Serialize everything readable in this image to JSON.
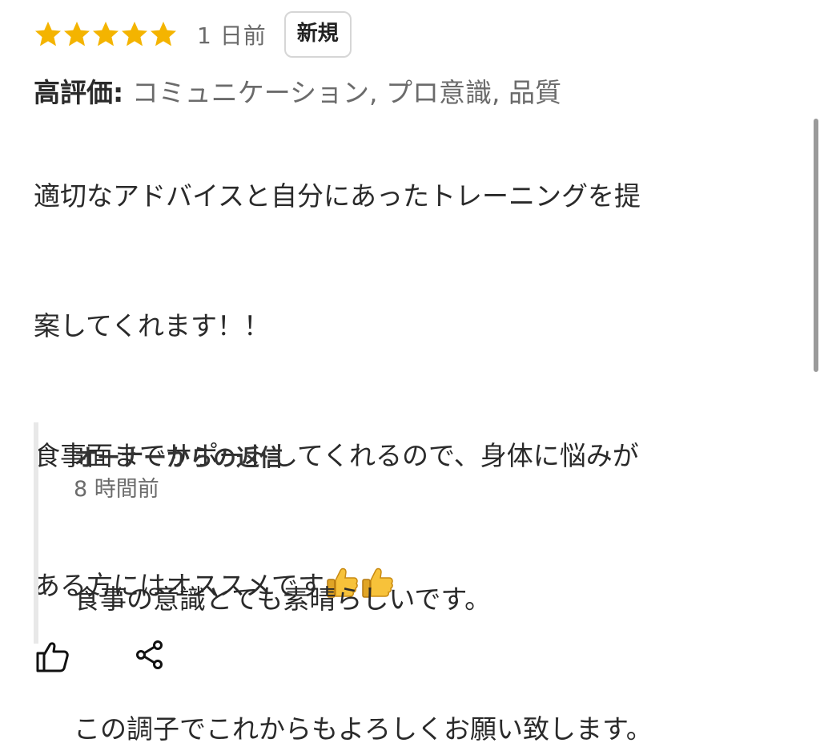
{
  "review": {
    "rating": 5,
    "rating_max": 5,
    "time_ago": "1 日前",
    "badge": "新規",
    "highlights_label": "高評価:",
    "highlights_value": " コミュニケーション, プロ意識, 品質",
    "text_lines": [
      "適切なアドバイスと自分にあったトレーニングを提",
      "案してくれます！！",
      "食事面までサポートしてくれるので、身体に悩みが",
      "ある方にはオススメです"
    ],
    "emoji_names": [
      "thumbs-up-emoji",
      "thumbs-up-emoji"
    ]
  },
  "actions": {
    "like_icon": "thumbs-up-outline-icon",
    "share_icon": "share-icon"
  },
  "owner_reply": {
    "title": "オーナーからの返信",
    "time_ago": "8 時間前",
    "text_lines": [
      "食事の意識とても素晴らしいです。",
      "この調子でこれからもよろしくお願い致します。"
    ]
  },
  "colors": {
    "star": "#f4b400",
    "muted": "#6b6b6b",
    "reply_border": "#e8e8e8"
  }
}
